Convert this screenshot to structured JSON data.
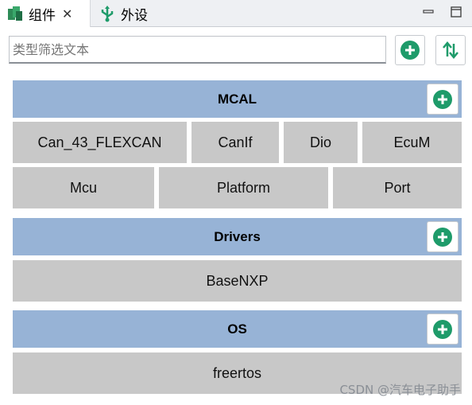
{
  "tabs": [
    {
      "label": "组件",
      "icon": "components-icon",
      "active": true
    },
    {
      "label": "外设",
      "icon": "usb-icon",
      "active": false
    }
  ],
  "filter": {
    "placeholder": "类型筛选文本",
    "value": ""
  },
  "groups": [
    {
      "title": "MCAL",
      "modules": [
        "Can_43_FLEXCAN",
        "CanIf",
        "Dio",
        "EcuM",
        "Mcu",
        "Platform",
        "Port"
      ]
    },
    {
      "title": "Drivers",
      "modules": [
        "BaseNXP"
      ]
    },
    {
      "title": "OS",
      "modules": [
        "freertos"
      ]
    }
  ],
  "watermark": "CSDN @汽车电子助手",
  "colors": {
    "header": "#97b3d6",
    "module": "#c8c8c8",
    "accent": "#1e9b6a"
  }
}
